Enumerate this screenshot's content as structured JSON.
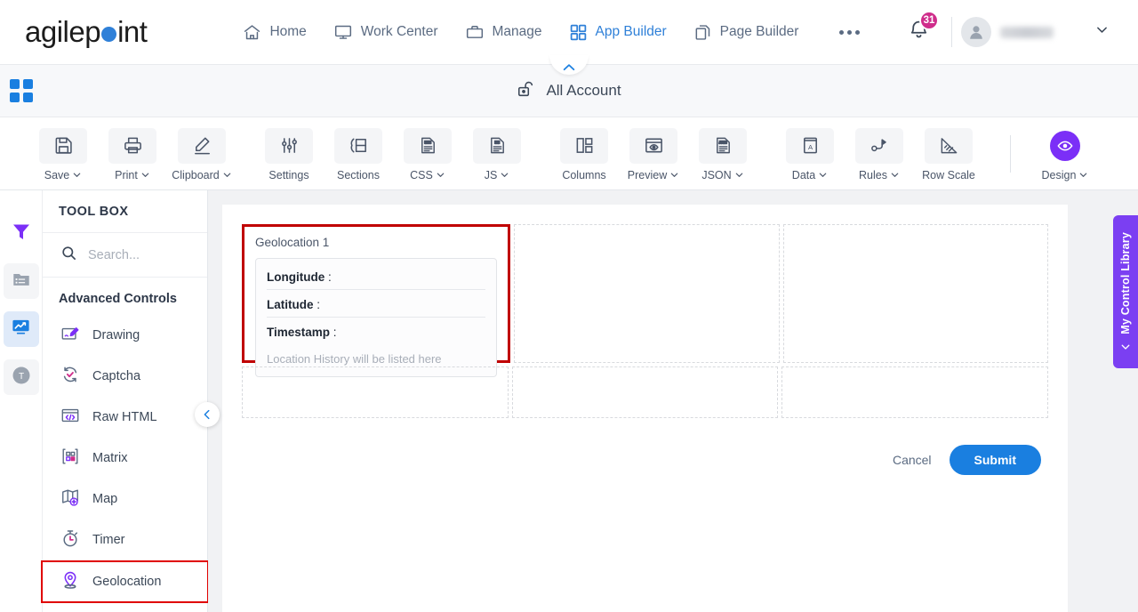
{
  "brand": {
    "name_before": "agilep",
    "name_after": "int",
    "accent": "#2f80d8"
  },
  "topnav": {
    "items": [
      {
        "label": "Home",
        "icon": "home-icon",
        "active": false
      },
      {
        "label": "Work Center",
        "icon": "monitor-icon",
        "active": false
      },
      {
        "label": "Manage",
        "icon": "briefcase-icon",
        "active": false
      },
      {
        "label": "App Builder",
        "icon": "grid-icon",
        "active": true
      },
      {
        "label": "Page Builder",
        "icon": "pages-icon",
        "active": false
      }
    ],
    "more_label": "More",
    "notification_count": "31",
    "notification_color": "#cf2d8b",
    "user_name": ""
  },
  "accountbar": {
    "label": "All Account",
    "icon": "unlock-icon"
  },
  "toolbar": {
    "buttons": [
      {
        "label": "Save",
        "icon": "save-icon",
        "dropdown": true
      },
      {
        "label": "Print",
        "icon": "print-icon",
        "dropdown": true
      },
      {
        "label": "Clipboard",
        "icon": "pencil-icon",
        "dropdown": true
      },
      {
        "label": "Settings",
        "icon": "sliders-icon",
        "dropdown": false
      },
      {
        "label": "Sections",
        "icon": "sections-icon",
        "dropdown": false
      },
      {
        "label": "CSS",
        "icon": "css-file-icon",
        "dropdown": true
      },
      {
        "label": "JS",
        "icon": "js-file-icon",
        "dropdown": true
      },
      {
        "label": "Columns",
        "icon": "columns-icon",
        "dropdown": false
      },
      {
        "label": "Preview",
        "icon": "eye-window-icon",
        "dropdown": true
      },
      {
        "label": "JSON",
        "icon": "json-file-icon",
        "dropdown": true
      },
      {
        "label": "Data",
        "icon": "book-icon",
        "dropdown": true
      },
      {
        "label": "Rules",
        "icon": "rules-icon",
        "dropdown": true
      },
      {
        "label": "Row Scale",
        "icon": "ruler-icon",
        "dropdown": false
      }
    ],
    "design": {
      "label": "Design",
      "icon": "eye-icon",
      "dropdown": true,
      "color": "#7b2ff7"
    }
  },
  "rail": [
    {
      "name": "filter-icon",
      "state": "normal"
    },
    {
      "name": "folder-list-icon",
      "state": "soft"
    },
    {
      "name": "chart-icon",
      "state": "active"
    },
    {
      "name": "text-icon",
      "state": "soft"
    }
  ],
  "toolbox": {
    "title": "TOOL BOX",
    "search_placeholder": "Search...",
    "search_value": "",
    "section_label": "Advanced Controls",
    "items": [
      {
        "label": "Drawing",
        "icon": "drawing-icon",
        "highlighted": false
      },
      {
        "label": "Captcha",
        "icon": "captcha-icon",
        "highlighted": false
      },
      {
        "label": "Raw HTML",
        "icon": "raw-html-icon",
        "highlighted": false
      },
      {
        "label": "Matrix",
        "icon": "matrix-icon",
        "highlighted": false
      },
      {
        "label": "Map",
        "icon": "map-icon",
        "highlighted": false
      },
      {
        "label": "Timer",
        "icon": "timer-icon",
        "highlighted": false
      },
      {
        "label": "Geolocation",
        "icon": "geolocation-icon",
        "highlighted": true
      }
    ],
    "highlight_color": "#e00000"
  },
  "canvas": {
    "geolocation": {
      "title": "Geolocation 1",
      "longitude_label": "Longitude",
      "latitude_label": "Latitude",
      "timestamp_label": "Timestamp",
      "separator": ":",
      "longitude_value": "",
      "latitude_value": "",
      "timestamp_value": "",
      "history_placeholder": "Location History will be listed here"
    },
    "actions": {
      "cancel_label": "Cancel",
      "submit_label": "Submit",
      "submit_color": "#1a7fe0"
    }
  },
  "library_tab": {
    "label": "My Control Library",
    "color": "#7b3ff2"
  }
}
